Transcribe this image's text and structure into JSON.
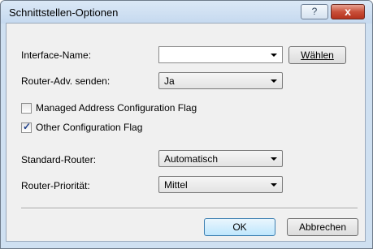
{
  "window": {
    "title": "Schnittstellen-Optionen",
    "help_label": "?",
    "close_label": "x"
  },
  "form": {
    "interface_name": {
      "label": "Interface-Name:",
      "value": ""
    },
    "choose_button_label": "Wählen",
    "router_adv": {
      "label": "Router-Adv. senden:",
      "value": "Ja"
    },
    "managed_flag": {
      "label": "Managed Address Configuration Flag",
      "checked": false
    },
    "other_flag": {
      "label": "Other Configuration Flag",
      "checked": true
    },
    "standard_router": {
      "label": "Standard-Router:",
      "value": "Automatisch"
    },
    "router_priority": {
      "label": "Router-Priorität:",
      "value": "Mittel"
    }
  },
  "footer": {
    "ok_label": "OK",
    "cancel_label": "Abbrechen"
  }
}
